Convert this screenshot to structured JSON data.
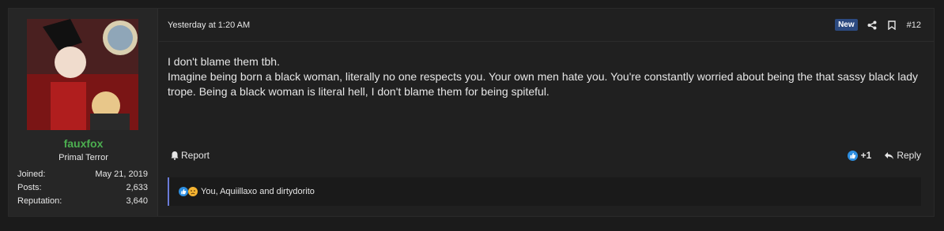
{
  "user": {
    "username": "fauxfox",
    "title": "Primal Terror",
    "stats": [
      {
        "label": "Joined:",
        "value": "May 21, 2019"
      },
      {
        "label": "Posts:",
        "value": "2,633"
      },
      {
        "label": "Reputation:",
        "value": "3,640"
      }
    ]
  },
  "post": {
    "date": "Yesterday at 1:20 AM",
    "badge": "New",
    "number": "#12",
    "lines": [
      "I don't blame them tbh.",
      "Imagine being born a black woman, literally no one respects you. Your own men hate you. You're constantly worried about being the that sassy black lady trope. Being a black woman is literal hell, I don't blame them for being spiteful."
    ]
  },
  "actions": {
    "report": "Report",
    "react_count": "+1",
    "reply": "Reply"
  },
  "reactions": {
    "text": "You, Aquiillaxo and dirtydorito"
  },
  "colors": {
    "username": "#4caf50",
    "badge": "#2c4a80",
    "reaction_border": "#6a7bd8",
    "like": "#2d8ee0"
  },
  "icons": [
    "share-icon",
    "bookmark-icon",
    "bell-icon",
    "like-icon",
    "reply-arrow-icon",
    "sad-face-icon"
  ]
}
